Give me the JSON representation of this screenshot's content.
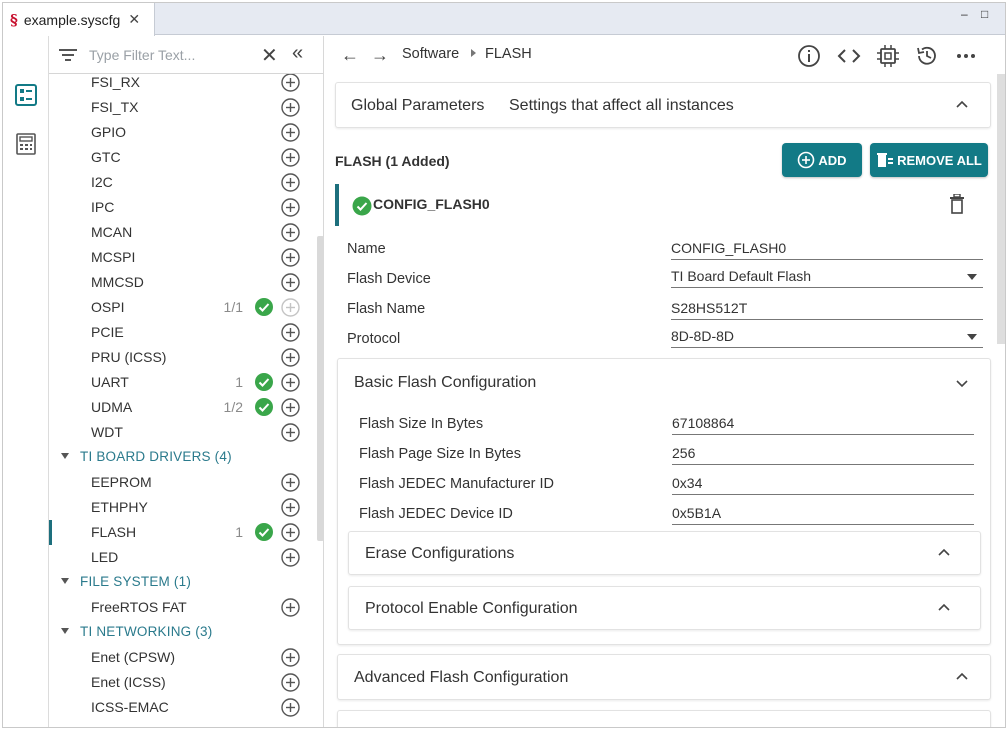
{
  "tab": {
    "logo": "§",
    "title": "example.syscfg",
    "close": "✕"
  },
  "window_controls": {
    "minimize": "‒",
    "maximize": "□"
  },
  "filter": {
    "placeholder": "Type Filter Text...",
    "clear": "✕",
    "collapse": "«"
  },
  "tree": [
    {
      "label": "FSI_RX",
      "type": "item"
    },
    {
      "label": "FSI_TX",
      "type": "item"
    },
    {
      "label": "GPIO",
      "type": "item"
    },
    {
      "label": "GTC",
      "type": "item"
    },
    {
      "label": "I2C",
      "type": "item"
    },
    {
      "label": "IPC",
      "type": "item"
    },
    {
      "label": "MCAN",
      "type": "item"
    },
    {
      "label": "MCSPI",
      "type": "item"
    },
    {
      "label": "MMCSD",
      "type": "item"
    },
    {
      "label": "OSPI",
      "type": "item",
      "count": "1/1",
      "checked": true,
      "add_disabled": true
    },
    {
      "label": "PCIE",
      "type": "item"
    },
    {
      "label": "PRU (ICSS)",
      "type": "item"
    },
    {
      "label": "UART",
      "type": "item",
      "count": "1",
      "checked": true
    },
    {
      "label": "UDMA",
      "type": "item",
      "count": "1/2",
      "checked": true
    },
    {
      "label": "WDT",
      "type": "item"
    },
    {
      "label": "TI BOARD DRIVERS (4)",
      "type": "group"
    },
    {
      "label": "EEPROM",
      "type": "item"
    },
    {
      "label": "ETHPHY",
      "type": "item"
    },
    {
      "label": "FLASH",
      "type": "item",
      "count": "1",
      "checked": true,
      "selected": true
    },
    {
      "label": "LED",
      "type": "item"
    },
    {
      "label": "FILE SYSTEM (1)",
      "type": "group"
    },
    {
      "label": "FreeRTOS FAT",
      "type": "item"
    },
    {
      "label": "TI NETWORKING (3)",
      "type": "group"
    },
    {
      "label": "Enet (CPSW)",
      "type": "item"
    },
    {
      "label": "Enet (ICSS)",
      "type": "item"
    },
    {
      "label": "ICSS-EMAC",
      "type": "item"
    }
  ],
  "breadcrumb": {
    "back": "←",
    "forward": "→",
    "items": [
      "Software",
      "FLASH"
    ]
  },
  "toolbar": {
    "icons": [
      "info-icon",
      "code-icon",
      "chip-icon",
      "history-icon",
      "more-icon"
    ]
  },
  "global_params": {
    "title": "Global Parameters",
    "subtitle": "Settings that affect all instances"
  },
  "module": {
    "title": "FLASH (1 Added)",
    "add_label": "ADD",
    "remove_all_label": "REMOVE ALL"
  },
  "instance": {
    "name": "CONFIG_FLASH0"
  },
  "fields": {
    "name": {
      "label": "Name",
      "value": "CONFIG_FLASH0"
    },
    "flash_device": {
      "label": "Flash Device",
      "value": "TI Board Default Flash"
    },
    "flash_name": {
      "label": "Flash Name",
      "value": "S28HS512T"
    },
    "protocol": {
      "label": "Protocol",
      "value": "8D-8D-8D"
    }
  },
  "basic_config": {
    "title": "Basic Flash Configuration",
    "size": {
      "label": "Flash Size In Bytes",
      "value": "67108864"
    },
    "page_size": {
      "label": "Flash Page Size In Bytes",
      "value": "256"
    },
    "manufacturer_id": {
      "label": "Flash JEDEC Manufacturer ID",
      "value": "0x34"
    },
    "device_id": {
      "label": "Flash JEDEC Device ID",
      "value": "0x5B1A"
    },
    "erase": "Erase Configurations",
    "protocol_enable": "Protocol Enable Configuration"
  },
  "advanced_config": {
    "title": "Advanced Flash Configuration"
  },
  "colors": {
    "accent": "#127a86",
    "check": "#3aa64a",
    "brand": "#c8102e",
    "group_text": "#2a7a8c"
  }
}
